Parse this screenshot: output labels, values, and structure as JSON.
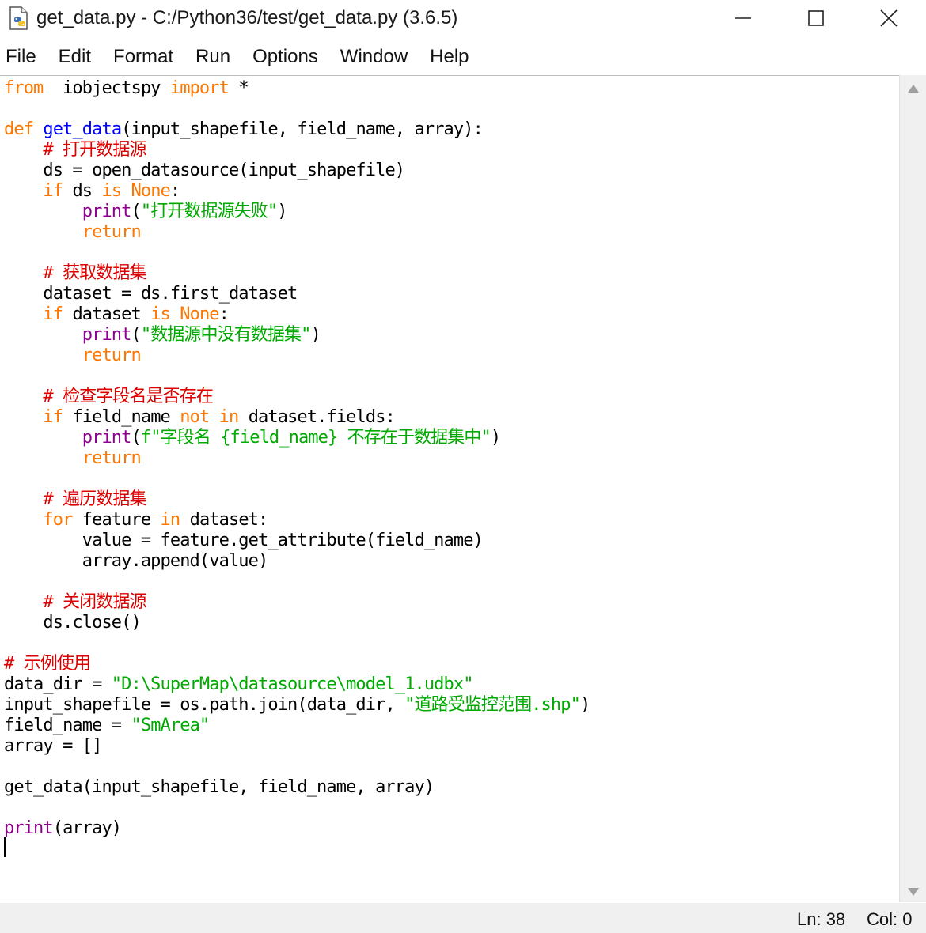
{
  "window": {
    "title": "get_data.py - C:/Python36/test/get_data.py (3.6.5)",
    "icon": "python-file-icon"
  },
  "menu": [
    "File",
    "Edit",
    "Format",
    "Run",
    "Options",
    "Window",
    "Help"
  ],
  "colors": {
    "keyword": "#ff7700",
    "builtin": "#900090",
    "definition": "#0000ff",
    "string": "#00aa00",
    "comment": "#dd0000"
  },
  "code": [
    [
      [
        "kw",
        "from"
      ],
      [
        "",
        "  iobjectspy "
      ],
      [
        "kw",
        "import"
      ],
      [
        "",
        " *"
      ]
    ],
    [],
    [
      [
        "kw",
        "def"
      ],
      [
        "",
        " "
      ],
      [
        "fn",
        "get_data"
      ],
      [
        "",
        "(input_shapefile, field_name, array):"
      ]
    ],
    [
      [
        "",
        "    "
      ],
      [
        "cm",
        "# 打开数据源"
      ]
    ],
    [
      [
        "",
        "    ds = open_datasource(input_shapefile)"
      ]
    ],
    [
      [
        "",
        "    "
      ],
      [
        "kw",
        "if"
      ],
      [
        "",
        " ds "
      ],
      [
        "kw",
        "is"
      ],
      [
        "",
        " "
      ],
      [
        "kw",
        "None"
      ],
      [
        "",
        ":"
      ]
    ],
    [
      [
        "",
        "        "
      ],
      [
        "bi",
        "print"
      ],
      [
        "",
        "("
      ],
      [
        "str",
        "\"打开数据源失败\""
      ],
      [
        "",
        ")"
      ]
    ],
    [
      [
        "",
        "        "
      ],
      [
        "kw",
        "return"
      ]
    ],
    [],
    [
      [
        "",
        "    "
      ],
      [
        "cm",
        "# 获取数据集"
      ]
    ],
    [
      [
        "",
        "    dataset = ds.first_dataset"
      ]
    ],
    [
      [
        "",
        "    "
      ],
      [
        "kw",
        "if"
      ],
      [
        "",
        " dataset "
      ],
      [
        "kw",
        "is"
      ],
      [
        "",
        " "
      ],
      [
        "kw",
        "None"
      ],
      [
        "",
        ":"
      ]
    ],
    [
      [
        "",
        "        "
      ],
      [
        "bi",
        "print"
      ],
      [
        "",
        "("
      ],
      [
        "str",
        "\"数据源中没有数据集\""
      ],
      [
        "",
        ")"
      ]
    ],
    [
      [
        "",
        "        "
      ],
      [
        "kw",
        "return"
      ]
    ],
    [],
    [
      [
        "",
        "    "
      ],
      [
        "cm",
        "# 检查字段名是否存在"
      ]
    ],
    [
      [
        "",
        "    "
      ],
      [
        "kw",
        "if"
      ],
      [
        "",
        " field_name "
      ],
      [
        "kw",
        "not"
      ],
      [
        "",
        " "
      ],
      [
        "kw",
        "in"
      ],
      [
        "",
        " dataset.fields:"
      ]
    ],
    [
      [
        "",
        "        "
      ],
      [
        "bi",
        "print"
      ],
      [
        "",
        "("
      ],
      [
        "str",
        "f\"字段名 {field_name} 不存在于数据集中\""
      ],
      [
        "",
        ")"
      ]
    ],
    [
      [
        "",
        "        "
      ],
      [
        "kw",
        "return"
      ]
    ],
    [],
    [
      [
        "",
        "    "
      ],
      [
        "cm",
        "# 遍历数据集"
      ]
    ],
    [
      [
        "",
        "    "
      ],
      [
        "kw",
        "for"
      ],
      [
        "",
        " feature "
      ],
      [
        "kw",
        "in"
      ],
      [
        "",
        " dataset:"
      ]
    ],
    [
      [
        "",
        "        value = feature.get_attribute(field_name)"
      ]
    ],
    [
      [
        "",
        "        array.append(value)"
      ]
    ],
    [],
    [
      [
        "",
        "    "
      ],
      [
        "cm",
        "# 关闭数据源"
      ]
    ],
    [
      [
        "",
        "    ds.close()"
      ]
    ],
    [],
    [
      [
        "cm",
        "# 示例使用"
      ]
    ],
    [
      [
        "",
        "data_dir = "
      ],
      [
        "str",
        "\"D:\\SuperMap\\datasource\\model_1.udbx\""
      ]
    ],
    [
      [
        "",
        "input_shapefile = os.path.join(data_dir, "
      ],
      [
        "str",
        "\"道路受监控范围.shp\""
      ],
      [
        "",
        ")"
      ]
    ],
    [
      [
        "",
        "field_name = "
      ],
      [
        "str",
        "\"SmArea\""
      ]
    ],
    [
      [
        "",
        "array = []"
      ]
    ],
    [],
    [
      [
        "",
        "get_data(input_shapefile, field_name, array)"
      ]
    ],
    [],
    [
      [
        "bi",
        "print"
      ],
      [
        "",
        "(array)"
      ]
    ],
    []
  ],
  "status": {
    "line": "Ln: 38",
    "col": "Col: 0"
  }
}
